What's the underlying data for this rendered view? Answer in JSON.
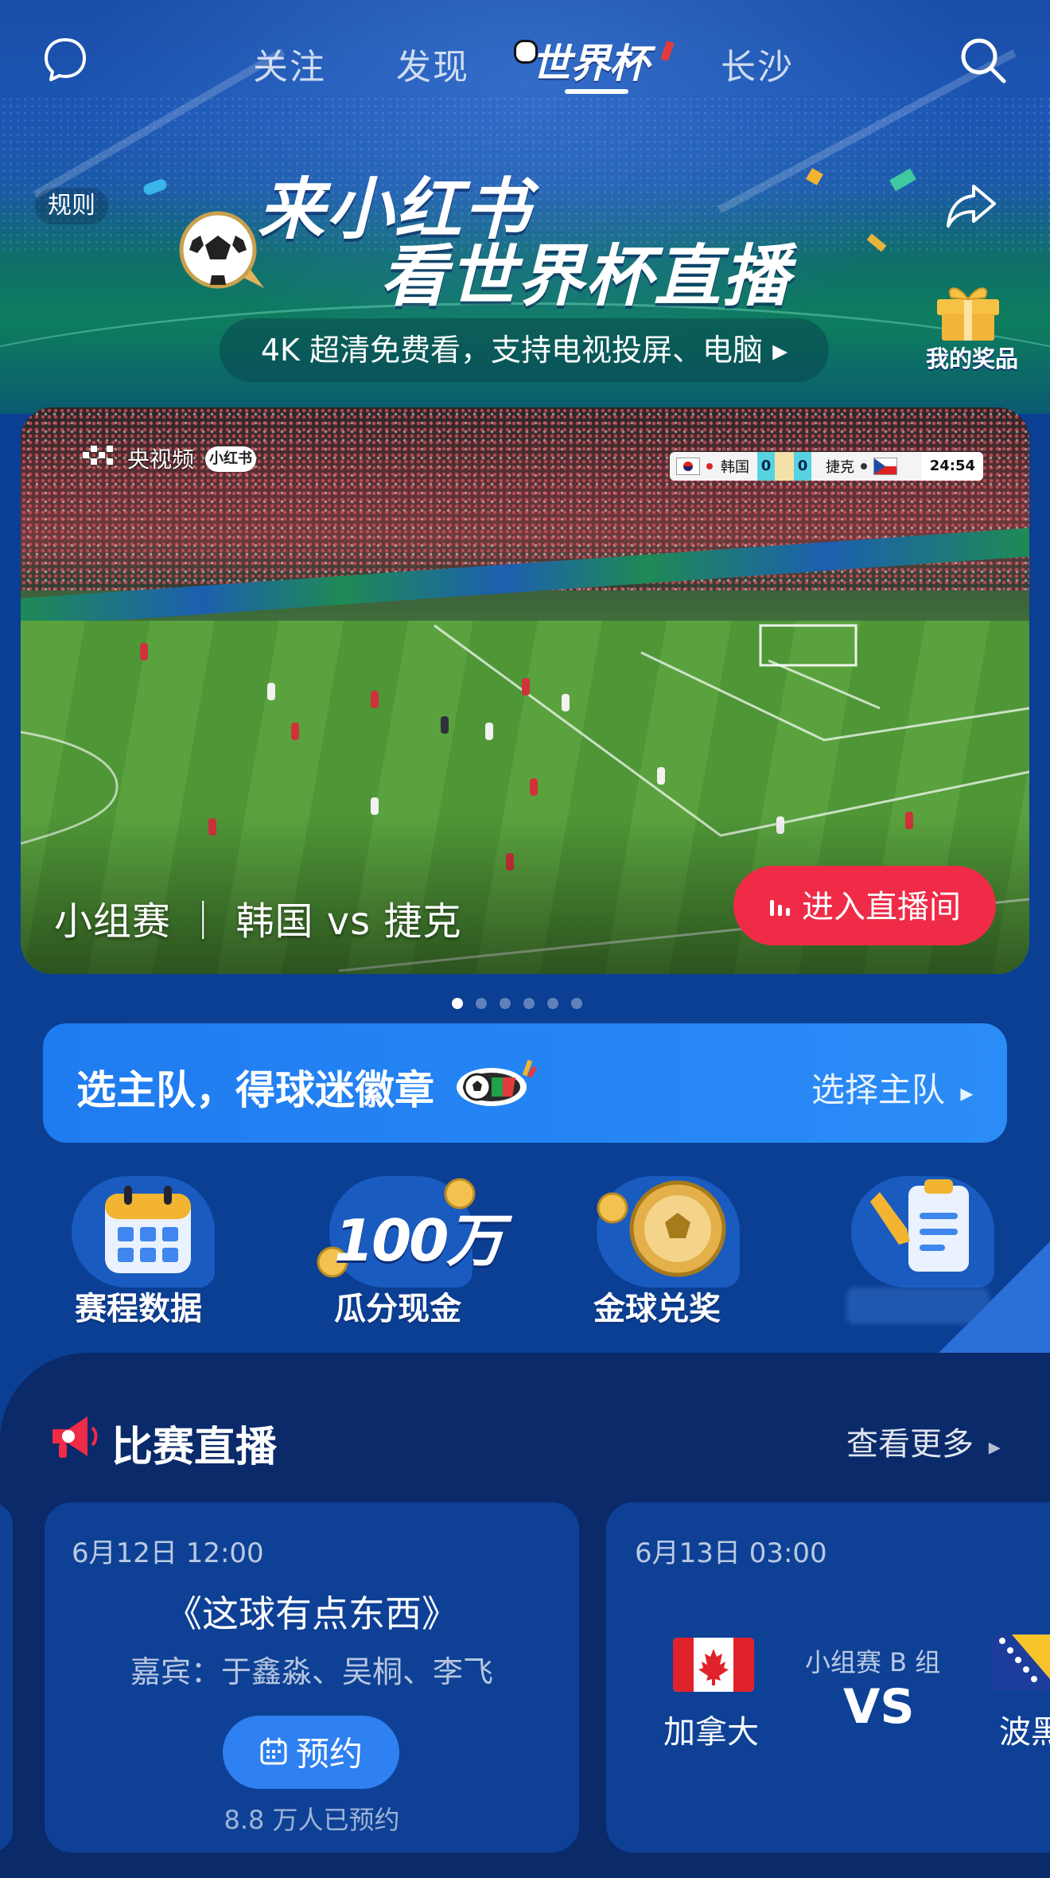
{
  "nav": {
    "tabs": [
      "关注",
      "发现",
      "世界杯",
      "长沙"
    ],
    "active_index": 2
  },
  "hero": {
    "rules_label": "规则",
    "title_line1": "来小红书",
    "title_line2": "看世界杯直播",
    "subtitle": "4K 超清免费看，支持电视投屏、电脑",
    "prize_label": "我的奖品"
  },
  "video": {
    "broadcaster": "央视频",
    "platform_badge": "小红书",
    "scoreboard": {
      "home_team": "韩国",
      "home_score": "0",
      "away_score": "0",
      "away_team": "捷克",
      "clock": "24:54"
    },
    "match_title": "小组赛 ｜ 韩国 vs 捷克",
    "cta_label": "进入直播间",
    "pager_count": 6,
    "pager_active": 0
  },
  "team_banner": {
    "title": "选主队，得球迷徽章",
    "action": "选择主队"
  },
  "quick_actions": [
    {
      "label": "赛程数据",
      "icon": "calendar-icon"
    },
    {
      "label": "瓜分现金",
      "icon": "coins-icon",
      "badge": "100万"
    },
    {
      "label": "金球兑奖",
      "icon": "gold-ball-icon"
    },
    {
      "label": "",
      "icon": "clipboard-icon"
    }
  ],
  "live_section": {
    "title": "比赛直播",
    "more": "查看更多"
  },
  "cards": [
    {
      "time": "6月12日 12:00",
      "show_title": "《这球有点东西》",
      "guests": "嘉宾：于鑫淼、吴桐、李飞",
      "button": "预约",
      "count": "8.8 万人已预约"
    },
    {
      "time": "6月13日 03:00",
      "group": "小组赛 B 组",
      "vs": "VS",
      "team1": "加拿大",
      "team2": "波黑"
    }
  ],
  "colors": {
    "live_red": "#ef2b47",
    "banner_blue": "#1f7cf0",
    "page_blue": "#0b3f93",
    "card_blue": "#0e4196"
  }
}
